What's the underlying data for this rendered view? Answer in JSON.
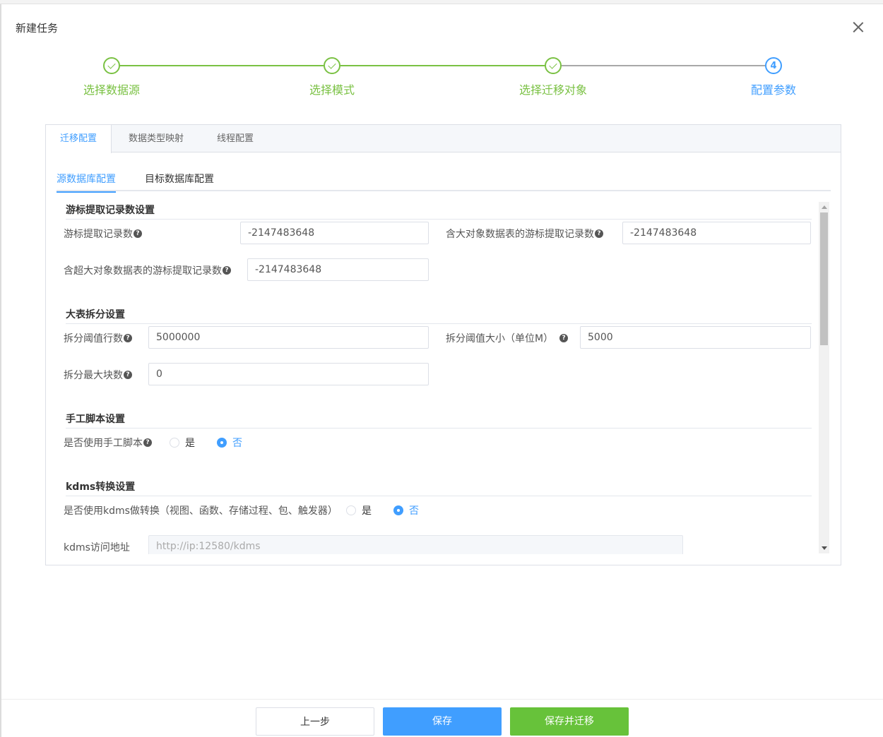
{
  "dialog": {
    "title": "新建任务"
  },
  "steps": [
    {
      "label": "选择数据源",
      "state": "done"
    },
    {
      "label": "选择模式",
      "state": "done"
    },
    {
      "label": "选择迁移对象",
      "state": "done"
    },
    {
      "label": "配置参数",
      "state": "active",
      "number": "4"
    }
  ],
  "tabs": [
    "迁移配置",
    "数据类型映射",
    "线程配置"
  ],
  "subtabs": [
    "源数据库配置",
    "目标数据库配置"
  ],
  "sections": {
    "cursor": {
      "title": "游标提取记录数设置",
      "fetch_label": "游标提取记录数",
      "fetch_value": "-2147483648",
      "lob_label": "含大对象数据表的游标提取记录数",
      "lob_value": "-2147483648",
      "large_lob_label": "含超大对象数据表的游标提取记录数",
      "large_lob_value": "-2147483648"
    },
    "split": {
      "title": "大表拆分设置",
      "rows_label": "拆分阈值行数",
      "rows_value": "5000000",
      "size_label": "拆分阈值大小（单位M）",
      "size_value": "5000",
      "blocks_label": "拆分最大块数",
      "blocks_value": "0"
    },
    "script": {
      "title": "手工脚本设置",
      "label": "是否使用手工脚本",
      "yes": "是",
      "no": "否",
      "selected": "否"
    },
    "kdms": {
      "title": "kdms转换设置",
      "label": "是否使用kdms做转换（视图、函数、存储过程、包、触发器）",
      "yes": "是",
      "no": "否",
      "selected": "否",
      "url_label": "kdms访问地址",
      "url_placeholder": "http://ip:12580/kdms"
    }
  },
  "footer": {
    "prev": "上一步",
    "save": "保存",
    "save_migrate": "保存并迁移"
  },
  "colors": {
    "primary": "#409eff",
    "success": "#67c23a",
    "step_done": "#7ac143"
  }
}
